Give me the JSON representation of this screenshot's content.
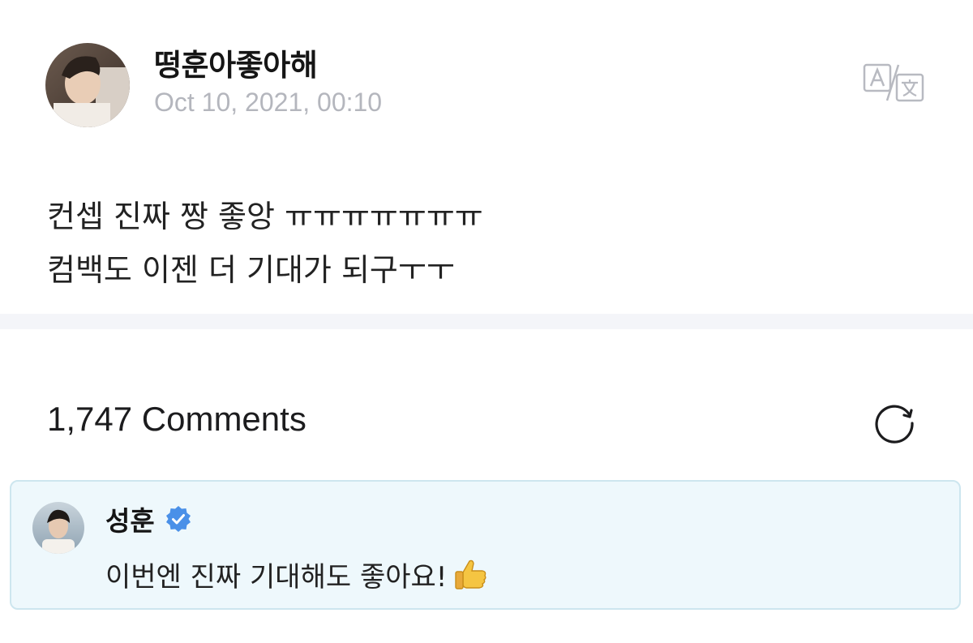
{
  "post": {
    "author": "떵훈아좋아해",
    "date": "Oct 10, 2021, 00:10",
    "avatar_icon": "user-avatar-photo",
    "translate_icon": "translate-icon",
    "body_lines": [
      "컨셉 진짜 짱 좋앙 ㅠㅠㅠㅠㅠㅠㅠ",
      "컴백도 이젠 더 기대가 되구ㅜㅜ"
    ]
  },
  "comments": {
    "count_label": "1,747 Comments",
    "refresh_icon": "refresh-icon",
    "pinned": {
      "author": "성훈",
      "verified_icon": "verified-badge-icon",
      "text": "이번엔 진짜 기대해도 좋아요!",
      "emoji_icon": "thumbs-up-icon"
    }
  },
  "colors": {
    "date_gray": "#b4b6bd",
    "divider": "#f4f5f9",
    "card_bg": "#eef8fc",
    "card_border": "#cde6ef",
    "verified_blue": "#4a90e8"
  }
}
